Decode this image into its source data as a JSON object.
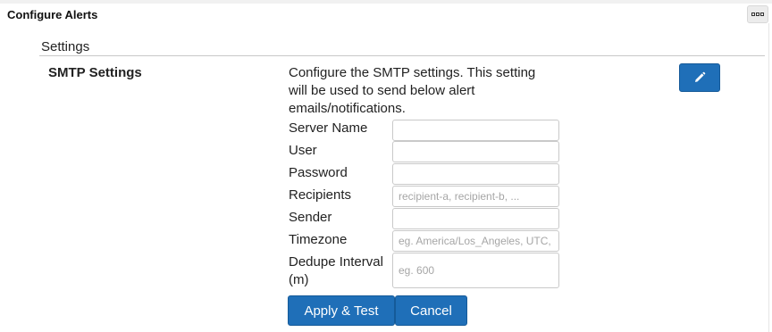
{
  "panel": {
    "title": "Configure Alerts",
    "menu_icon": "ellipsis-icon"
  },
  "section": {
    "title": "Settings"
  },
  "smtp": {
    "heading": "SMTP Settings",
    "description": "Configure the SMTP settings. This setting will be used to send below alert emails/notifications.",
    "edit_icon": "pencil-icon",
    "fields": [
      {
        "label": "Server Name",
        "value": "",
        "placeholder": ""
      },
      {
        "label": "User",
        "value": "",
        "placeholder": ""
      },
      {
        "label": "Password",
        "value": "",
        "placeholder": ""
      },
      {
        "label": "Recipients",
        "value": "",
        "placeholder": "recipient-a, recipient-b, ..."
      },
      {
        "label": "Sender",
        "value": "",
        "placeholder": ""
      },
      {
        "label": "Timezone",
        "value": "",
        "placeholder": "eg. America/Los_Angeles, UTC, ..."
      },
      {
        "label": "Dedupe Interval (m)",
        "value": "",
        "placeholder": "eg. 600"
      }
    ],
    "buttons": {
      "apply_label": "Apply & Test",
      "cancel_label": "Cancel"
    }
  },
  "colors": {
    "primary": "#1f6fb8",
    "border": "#c9c9c9",
    "text": "#222222"
  }
}
